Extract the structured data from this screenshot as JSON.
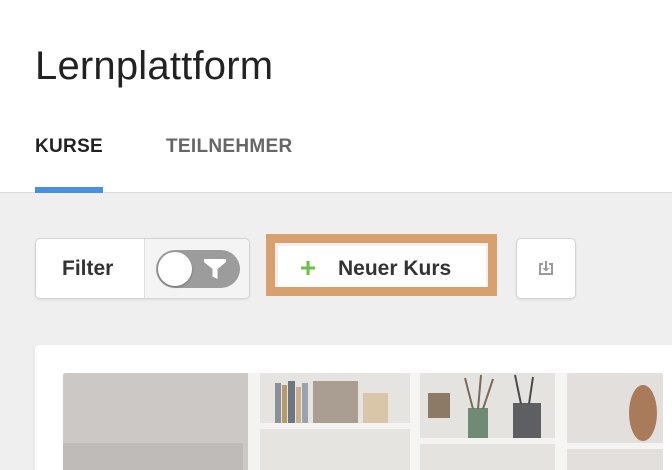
{
  "header": {
    "title": "Lernplattform",
    "tabs": [
      {
        "label": "KURSE",
        "active": true
      },
      {
        "label": "TEILNEHMER",
        "active": false
      }
    ]
  },
  "toolbar": {
    "filter_label": "Filter",
    "filter_toggle": {
      "on": false,
      "icon": "funnel-icon"
    },
    "new_course_label": "Neuer Kurs",
    "new_course_icon": "plus-icon",
    "export_icon": "export-icon"
  },
  "colors": {
    "accent": "#4a90e2",
    "highlight": "#d9a06f",
    "plus": "#6cc04a",
    "toggle_off": "#9c9c9c"
  },
  "course_card": {
    "image": "course-cover-image"
  }
}
